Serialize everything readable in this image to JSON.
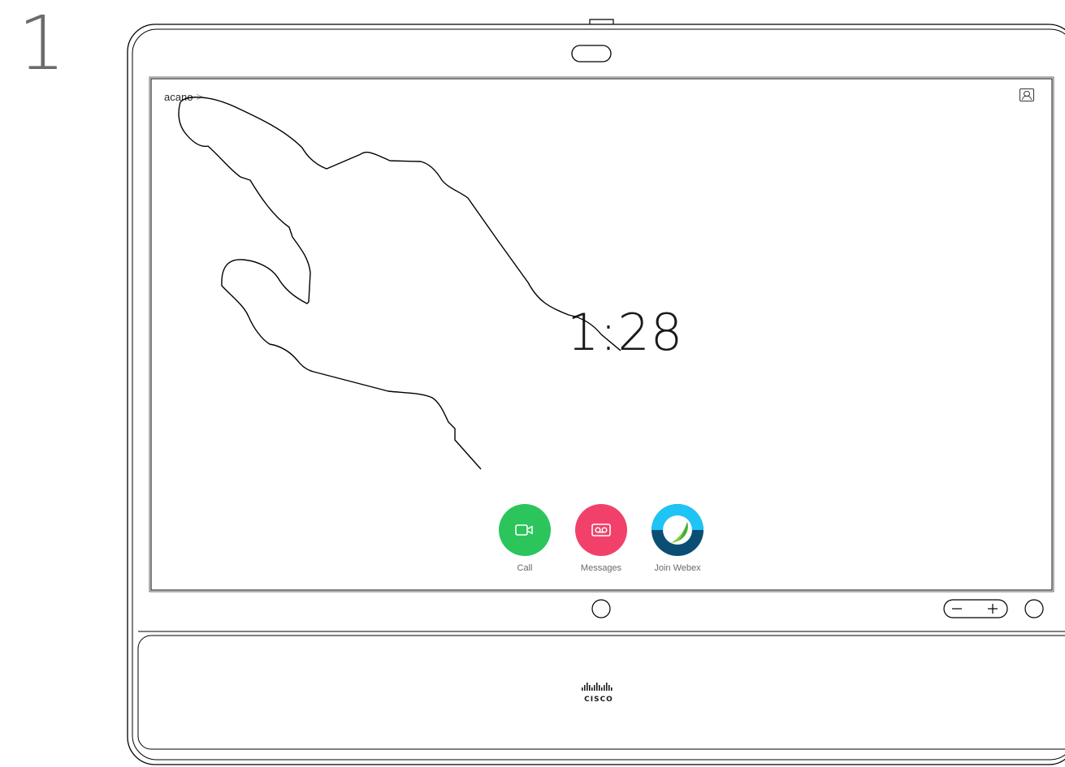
{
  "step": {
    "number": "1"
  },
  "screen": {
    "breadcrumb": {
      "label": "acano",
      "chevron": ">"
    },
    "clock": {
      "time": "1:28"
    },
    "actions": [
      {
        "label": "Call",
        "icon": "video-camera-icon",
        "color": "#2bc55c"
      },
      {
        "label": "Messages",
        "icon": "voicemail-icon",
        "color": "#f1416a"
      },
      {
        "label": "Join Webex",
        "icon": "webex-logo-icon",
        "color": "#0a4f73"
      }
    ]
  },
  "device": {
    "brand": "CISCO",
    "hardware_buttons": [
      "home-button",
      "volume-control",
      "power-button"
    ]
  }
}
